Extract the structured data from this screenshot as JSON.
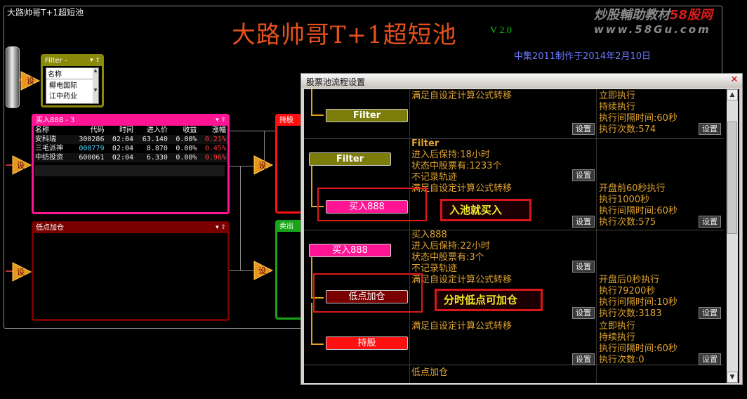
{
  "app": {
    "window_title": "大路帅哥T+1超短池",
    "title": "大路帅哥T+1超短池",
    "version": "V 2.0",
    "subtitle": "中集2011制作于2014年2月10日"
  },
  "watermark": {
    "line1_a": "炒股輔助教材",
    "line1_b": "58股网",
    "line2": "www.58Gu.com"
  },
  "filter_panel": {
    "title": "Filter - ",
    "header": "名称",
    "items": [
      "椰电国际",
      "江中药业"
    ]
  },
  "buy_panel": {
    "title": "买入888 - 3",
    "columns": [
      "名称",
      "代码",
      "时间",
      "进入价",
      "收益",
      "涨幅"
    ],
    "rows": [
      [
        "安科瑞",
        "300286",
        "02:04",
        "63.140",
        "0.00%",
        "0.21%"
      ],
      [
        "三毛派神",
        "000779",
        "02:04",
        "8.870",
        "0.00%",
        "0.45%"
      ],
      [
        "中纺投资",
        "600061",
        "02:04",
        "6.330",
        "0.00%",
        "0.96%"
      ]
    ]
  },
  "lowadd_panel": {
    "title": "低点加仓"
  },
  "hold_panel": {
    "title": "持股"
  },
  "sell_panel": {
    "title": "卖出"
  },
  "node_label": "设",
  "dialog": {
    "title": "股票池流程设置",
    "set_label": "设置",
    "rows": [
      {
        "stage": "Filter",
        "mid": [
          "满足自设定计算公式转移"
        ],
        "right": [
          "立即执行",
          "持续执行",
          "执行间隔时间:60秒",
          "执行次数:574"
        ]
      },
      {
        "stage": "Filter",
        "mid": [
          "Filter",
          "进入后保持:18小时",
          "状态中股票有:1233个",
          "不记录轨迹"
        ],
        "right": []
      },
      {
        "stage": "买入888",
        "mid": [
          "满足自设定计算公式转移"
        ],
        "right": [
          "开盘前60秒执行",
          "执行1000秒",
          "执行间隔时间:60秒",
          "执行次数:575"
        ]
      },
      {
        "stage": "买入888",
        "mid": [
          "买入888",
          "进入后保持:22小时",
          "状态中股票有:3个",
          "不记录轨迹"
        ],
        "right": []
      },
      {
        "stage": "低点加仓",
        "mid": [
          "满足自设定计算公式转移"
        ],
        "right": [
          "开盘后0秒执行",
          "执行79200秒",
          "执行间隔时间:10秒",
          "执行次数:3183"
        ]
      },
      {
        "stage": "持股",
        "mid": [
          "满足自设定计算公式转移"
        ],
        "right": [
          "立即执行",
          "持续执行",
          "执行间隔时间:60秒",
          "执行次数:0"
        ]
      },
      {
        "stage": "",
        "mid": [
          "低点加仓"
        ],
        "right": []
      }
    ],
    "callout1": "入池就买入",
    "callout2": "分时低点可加仓"
  },
  "colors": {
    "title": "#e4511a",
    "filter": "#7c7c0a",
    "buy": "#ff1493",
    "lowadd": "#7a0000",
    "hold": "#ff1010",
    "sell": "#17a517",
    "callout_text": "#f0ea2a",
    "dialog_text": "#e0a331"
  }
}
